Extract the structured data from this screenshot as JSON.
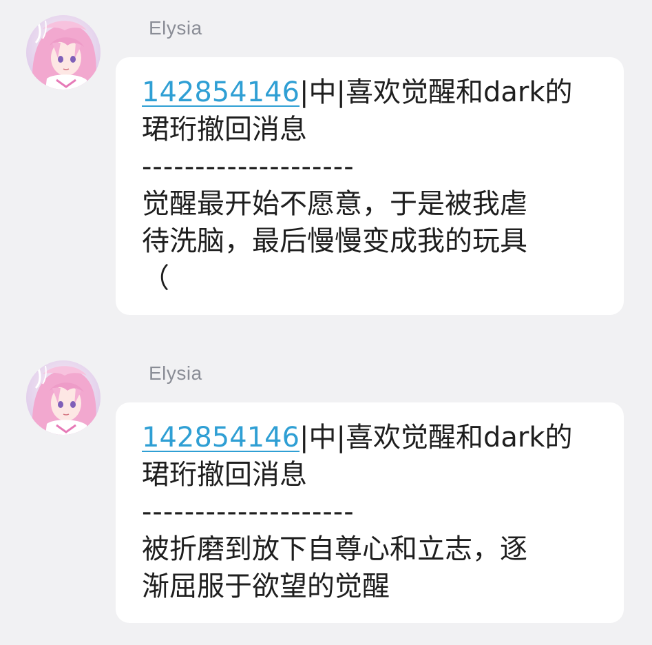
{
  "messages": [
    {
      "sender": "Elysia",
      "qq_number": "142854146",
      "title_rest": "|中|喜欢觉醒和dark的",
      "title_line2": "珺珩撤回消息",
      "separator": "--------------------",
      "body_lines": [
        "觉醒最开始不愿意，于是被我虐",
        "待洗脑，最后慢慢变成我的玩具",
        "（"
      ]
    },
    {
      "sender": "Elysia",
      "qq_number": "142854146",
      "title_rest": "|中|喜欢觉醒和dark的",
      "title_line2": "珺珩撤回消息",
      "separator": "--------------------",
      "body_lines": [
        "被折磨到放下自尊心和立志，逐",
        "渐屈服于欲望的觉醒"
      ]
    }
  ],
  "colors": {
    "background": "#f1f1f3",
    "bubble": "#ffffff",
    "link": "#2f9fd4",
    "sender_name": "#8a8d96",
    "text": "#1e1e1e"
  },
  "icons": {
    "avatar": "anime-girl-pink-hair-avatar"
  }
}
